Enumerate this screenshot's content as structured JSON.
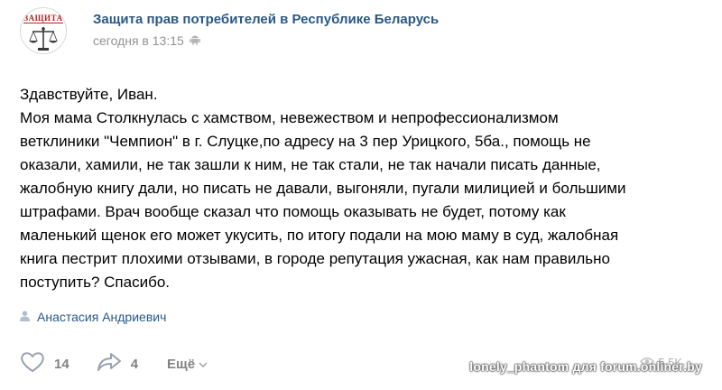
{
  "header": {
    "avatar_text": "ЗАЩИТА",
    "group_name": "Защита прав потребителей в Республике Беларусь",
    "time": "сегодня в 13:15",
    "device_icon": "android-icon"
  },
  "post": {
    "lines": [
      "Здавствуйте, Иван.",
      "Моя мама Столкнулась с хамством, невежеством и непрофессионализмом",
      "ветклиники \"Чемпион\" в г. Слуцке,по адресу на 3 пер Урицкого, 5ба., помощь не",
      "оказали, хамили, не так зашли к ним, не так стали, не так начали писать данные,",
      "жалобную книгу дали, но писать не давали, выгоняли, пугали милицией и большими",
      "штрафами. Врач вообще сказал что помощь оказывать не будет, потому как",
      "маленький щенок его может укусить, по итогу подали на мою маму в суд, жалобная",
      "книга пестрит плохими отзывами, в городе репутация ужасная, как нам правильно",
      "поступить? Спасибо."
    ],
    "signer": "Анастасия Андриевич"
  },
  "footer": {
    "likes": "14",
    "shares": "4",
    "more_label": "Ещё",
    "views": "5.5K"
  },
  "watermark": "lonely_phantom для forum.onliner.by",
  "colors": {
    "link": "#2a5885",
    "muted": "#939393",
    "action": "#828282",
    "avatar_red": "#b0251e"
  }
}
